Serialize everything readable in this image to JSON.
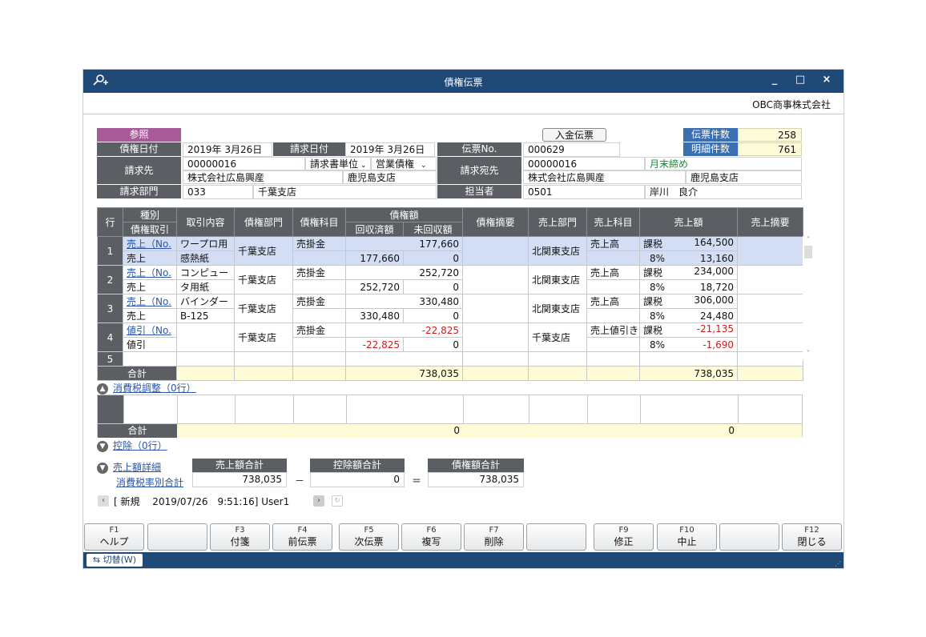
{
  "window": {
    "title": "債権伝票",
    "company": "OBC商事株式会社",
    "controls": [
      "_",
      "□",
      "×"
    ]
  },
  "header": {
    "ref_label": "参照",
    "payment_btn": "入金伝票",
    "debt_date_label": "債権日付",
    "debt_date": "2019年  3月26日",
    "bill_date_label": "請求日付",
    "bill_date": "2019年  3月26日",
    "slip_no_label": "伝票No.",
    "slip_no": "000629",
    "slip_count_label": "伝票件数",
    "slip_count": "258",
    "detail_count_label": "明細件数",
    "detail_count": "761",
    "bill_to_label": "請求先",
    "bill_to_code": "00000016",
    "bill_unit_select": "請求書単位",
    "debt_type_select": "営業債権",
    "bill_to_name": "株式会社広島興産",
    "bill_to_branch": "鹿児島支店",
    "bill_addr_label": "請求宛先",
    "bill_addr_code": "00000016",
    "closing": "月末締め",
    "bill_addr_name": "株式会社広島興産",
    "bill_addr_branch": "鹿児島支店",
    "dept_label": "請求部門",
    "dept_code": "033",
    "dept_name": "千葉支店",
    "staff_label": "担当者",
    "staff_code": "0501",
    "staff_name": "岸川　良介"
  },
  "grid": {
    "headers": {
      "row": "行",
      "kind": "種別",
      "kind_sub": "債権取引",
      "content": "取引内容",
      "dept": "債権部門",
      "account": "債権科目",
      "amount": "債権額",
      "collected": "回収済額",
      "uncollected": "未回収額",
      "summary": "債権摘要",
      "sales_dept": "売上部門",
      "sales_account": "売上科目",
      "sales_amount": "売上額",
      "sales_summary": "売上摘要"
    },
    "rows": [
      {
        "no": "1",
        "kind": "売上（No.",
        "kind2": "売上",
        "content": "ワープロ用",
        "content2": "感熱紙",
        "dept": "千葉支店",
        "account": "売掛金",
        "amount": "177,660",
        "collected": "177,660",
        "uncollected": "0",
        "sales_dept": "北関東支店",
        "sales_account": "売上高",
        "tax": "課税",
        "sales_amount": "164,500",
        "rate": "8%",
        "tax_amount": "13,160"
      },
      {
        "no": "2",
        "kind": "売上（No.",
        "kind2": "売上",
        "content": "コンピュー",
        "content2": "タ用紙",
        "dept": "千葉支店",
        "account": "売掛金",
        "amount": "252,720",
        "collected": "252,720",
        "uncollected": "0",
        "sales_dept": "北関東支店",
        "sales_account": "売上高",
        "tax": "課税",
        "sales_amount": "234,000",
        "rate": "8%",
        "tax_amount": "18,720"
      },
      {
        "no": "3",
        "kind": "売上（No.",
        "kind2": "売上",
        "content": "バインダー",
        "content2": "B-125",
        "dept": "千葉支店",
        "account": "売掛金",
        "amount": "330,480",
        "collected": "330,480",
        "uncollected": "0",
        "sales_dept": "北関東支店",
        "sales_account": "売上高",
        "tax": "課税",
        "sales_amount": "306,000",
        "rate": "8%",
        "tax_amount": "24,480"
      },
      {
        "no": "4",
        "kind": "値引（No.",
        "kind2": "値引",
        "content": "",
        "content2": "",
        "dept": "千葉支店",
        "account": "売掛金",
        "amount": "-22,825",
        "collected": "-22,825",
        "uncollected": "0",
        "sales_dept": "千葉支店",
        "sales_account": "売上値引き",
        "tax": "課税",
        "sales_amount": "-21,135",
        "rate": "8%",
        "tax_amount": "-1,690"
      },
      {
        "no": "5"
      }
    ],
    "total_label": "合計",
    "total_amount": "738,035",
    "total_sales": "738,035"
  },
  "tax_adjust": {
    "title": "消費税調整（0行）",
    "total_label": "合計",
    "total_amount": "0",
    "total_sales": "0"
  },
  "deduction": {
    "title": "控除（0行）"
  },
  "summary": {
    "detail_title": "売上額詳細",
    "tax_rate_link": "消費税率別合計",
    "sales_total_label": "売上額合計",
    "sales_total": "738,035",
    "minus": "－",
    "deduct_total_label": "控除額合計",
    "deduct_total": "0",
    "equals": "＝",
    "debt_total_label": "債権額合計",
    "debt_total": "738,035"
  },
  "status": {
    "text": "[ 新規　 2019/07/26　9:51:16] User1"
  },
  "fkeys": [
    {
      "key": "F1",
      "label": "ヘルプ"
    },
    {
      "key": "",
      "label": ""
    },
    {
      "key": "F3",
      "label": "付箋"
    },
    {
      "key": "F4",
      "label": "前伝票"
    },
    {
      "key": "F5",
      "label": "次伝票"
    },
    {
      "key": "F6",
      "label": "複写"
    },
    {
      "key": "F7",
      "label": "削除"
    },
    {
      "key": "",
      "label": ""
    },
    {
      "key": "F9",
      "label": "修正"
    },
    {
      "key": "F10",
      "label": "中止"
    },
    {
      "key": "",
      "label": ""
    },
    {
      "key": "F12",
      "label": "閉じる"
    }
  ],
  "switch_label": "切替(W)"
}
